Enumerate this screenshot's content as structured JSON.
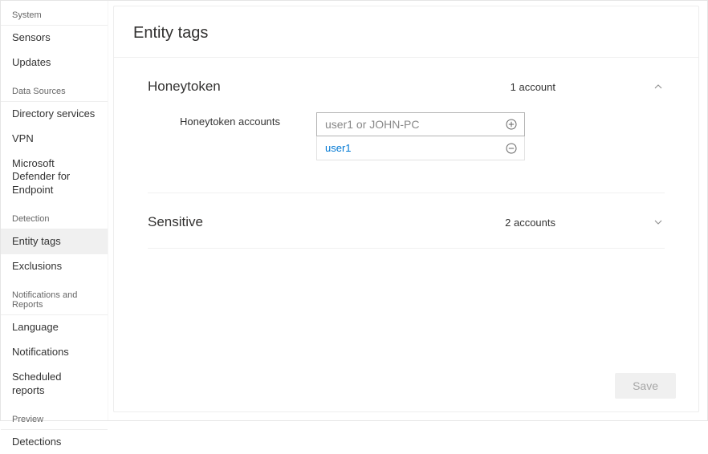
{
  "page": {
    "title": "Entity tags"
  },
  "sidebar": {
    "groups": [
      {
        "header": "System",
        "items": [
          "Sensors",
          "Updates"
        ]
      },
      {
        "header": "Data Sources",
        "items": [
          "Directory services",
          "VPN",
          "Microsoft Defender for Endpoint"
        ]
      },
      {
        "header": "Detection",
        "items": [
          "Entity tags",
          "Exclusions"
        ],
        "active": "Entity tags"
      },
      {
        "header": "Notifications and Reports",
        "items": [
          "Language",
          "Notifications",
          "Scheduled reports"
        ]
      },
      {
        "header": "Preview",
        "items": [
          "Detections"
        ]
      }
    ]
  },
  "sections": {
    "honeytoken": {
      "title": "Honeytoken",
      "meta": "1 account",
      "expanded": true,
      "field_label": "Honeytoken accounts",
      "input_placeholder": "user1 or JOHN-PC",
      "items": [
        "user1"
      ]
    },
    "sensitive": {
      "title": "Sensitive",
      "meta": "2 accounts",
      "expanded": false
    }
  },
  "footer": {
    "save": "Save"
  }
}
